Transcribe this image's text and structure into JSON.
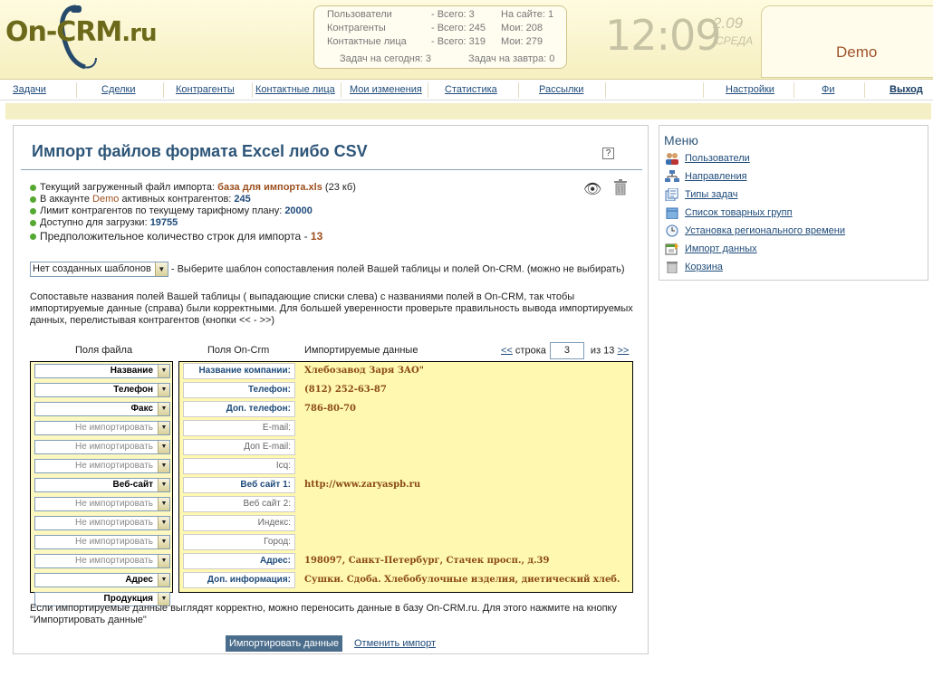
{
  "header": {
    "logo_text": "On-CRM",
    "logo_domain": ".ru",
    "stats": {
      "row1": {
        "label": "Пользователи",
        "total": "- Всего: 3",
        "extra": "На сайте: 1"
      },
      "row2": {
        "label": "Контрагенты",
        "total": "- Всего: 245",
        "extra": "Мои: 208"
      },
      "row3": {
        "label": "Контактные лица",
        "total": "- Всего: 319",
        "extra": "Мои: 279"
      },
      "today": "Задач на сегодня: 3",
      "tomorrow": "Задач на завтра: 0"
    },
    "clock": "12:09",
    "date_num": "2.09",
    "date_day": "СРЕДА",
    "user": "Demo"
  },
  "nav": {
    "tasks": "Задачи",
    "deals": "Сделки",
    "counterparties": "Контрагенты",
    "contacts": "Контактные лица",
    "my_changes": "Мои изменения",
    "statistics": "Статистика",
    "mailings": "Рассылки",
    "settings": "Настройки",
    "fi": "Фи",
    "logout": "Выход"
  },
  "main": {
    "title": "Импорт файлов формата Excel либо CSV",
    "help": "?",
    "info": {
      "file_label": "Текущий загруженный файл импорта: ",
      "file_name": "база для импорта.xls",
      "file_size": " (23 кб)",
      "acc_label_pre": "В аккаунте ",
      "acc_name": "Demo",
      "acc_label_post": " активных контрагентов: ",
      "acc_count": "245",
      "limit_label": "Лимит контрагентов по текущему тарифному плану: ",
      "limit_value": "20000",
      "available_label": "Доступно для загрузки: ",
      "available_value": "19755",
      "rows_label": "Предположительное количество строк для импорта - ",
      "rows_value": "13"
    },
    "template_select": "Нет созданных шаблонов",
    "template_hint": " - Выберите шаблон сопоставления полей Вашей таблицы и полей On-CRM. (можно не выбирать)",
    "description": "Сопоставьте названия полей Вашей таблицы ( выпадающие списки слева) с названиями полей в On-CRM, так чтобы импортируемые данные (справа) были корректными. Для большей уверенности проверьте правильность вывода импортируемых данных, перелистывая контрагентов (кнопки <<  - >>)",
    "col_file": "Поля файла",
    "col_crm": "Поля On-Crm",
    "col_data": "Импортируемые данные",
    "pager": {
      "prev": "<<",
      "row_label": " строка",
      "current": "3",
      "of_label": " из 13 ",
      "next": ">>"
    },
    "file_fields": [
      "Название",
      "Телефон",
      "Факс",
      "Не импортировать",
      "Не импортировать",
      "Не импортировать",
      "Веб-сайт",
      "Не импортировать",
      "Не импортировать",
      "Не импортировать",
      "Не импортировать",
      "Адрес",
      "Продукция"
    ],
    "crm_fields": [
      "Название компании:",
      "Телефон:",
      "Доп. телефон:",
      "E-mail:",
      "Доп E-mail:",
      "Icq:",
      "Веб сайт 1:",
      "Веб сайт 2:",
      "Индекс:",
      "Город:",
      "Адрес:",
      "Доп. информация:"
    ],
    "values": [
      "Хлебозавод Заря ЗАО\"",
      "(812) 252-63-87",
      "786-80-70",
      "",
      "",
      "",
      "http://www.zaryaspb.ru",
      "",
      "",
      "",
      "198097, Санкт-Петербург, Стачек просп., д.39",
      "Сушки. Сдоба. Хлебобулочные изделия, диетический хлеб."
    ],
    "footer": "Если импортируемые данные выглядят корректно, можно переносить данные в базу On-CRM.ru. Для этого нажмите на кнопку \"Импортировать данные\"",
    "import_button": "Импортировать данные",
    "cancel_link": "Отменить импорт"
  },
  "menu": {
    "title": "Меню",
    "items": [
      {
        "label": "Пользователи",
        "icon": "users-icon"
      },
      {
        "label": "Направления",
        "icon": "directions-icon"
      },
      {
        "label": "Типы задач",
        "icon": "task-types-icon"
      },
      {
        "label": "Список товарных групп",
        "icon": "product-groups-icon"
      },
      {
        "label": "Установка регионального времени",
        "icon": "clock-icon"
      },
      {
        "label": "Импорт данных",
        "icon": "import-icon"
      },
      {
        "label": "Корзина",
        "icon": "trash-icon"
      }
    ]
  }
}
